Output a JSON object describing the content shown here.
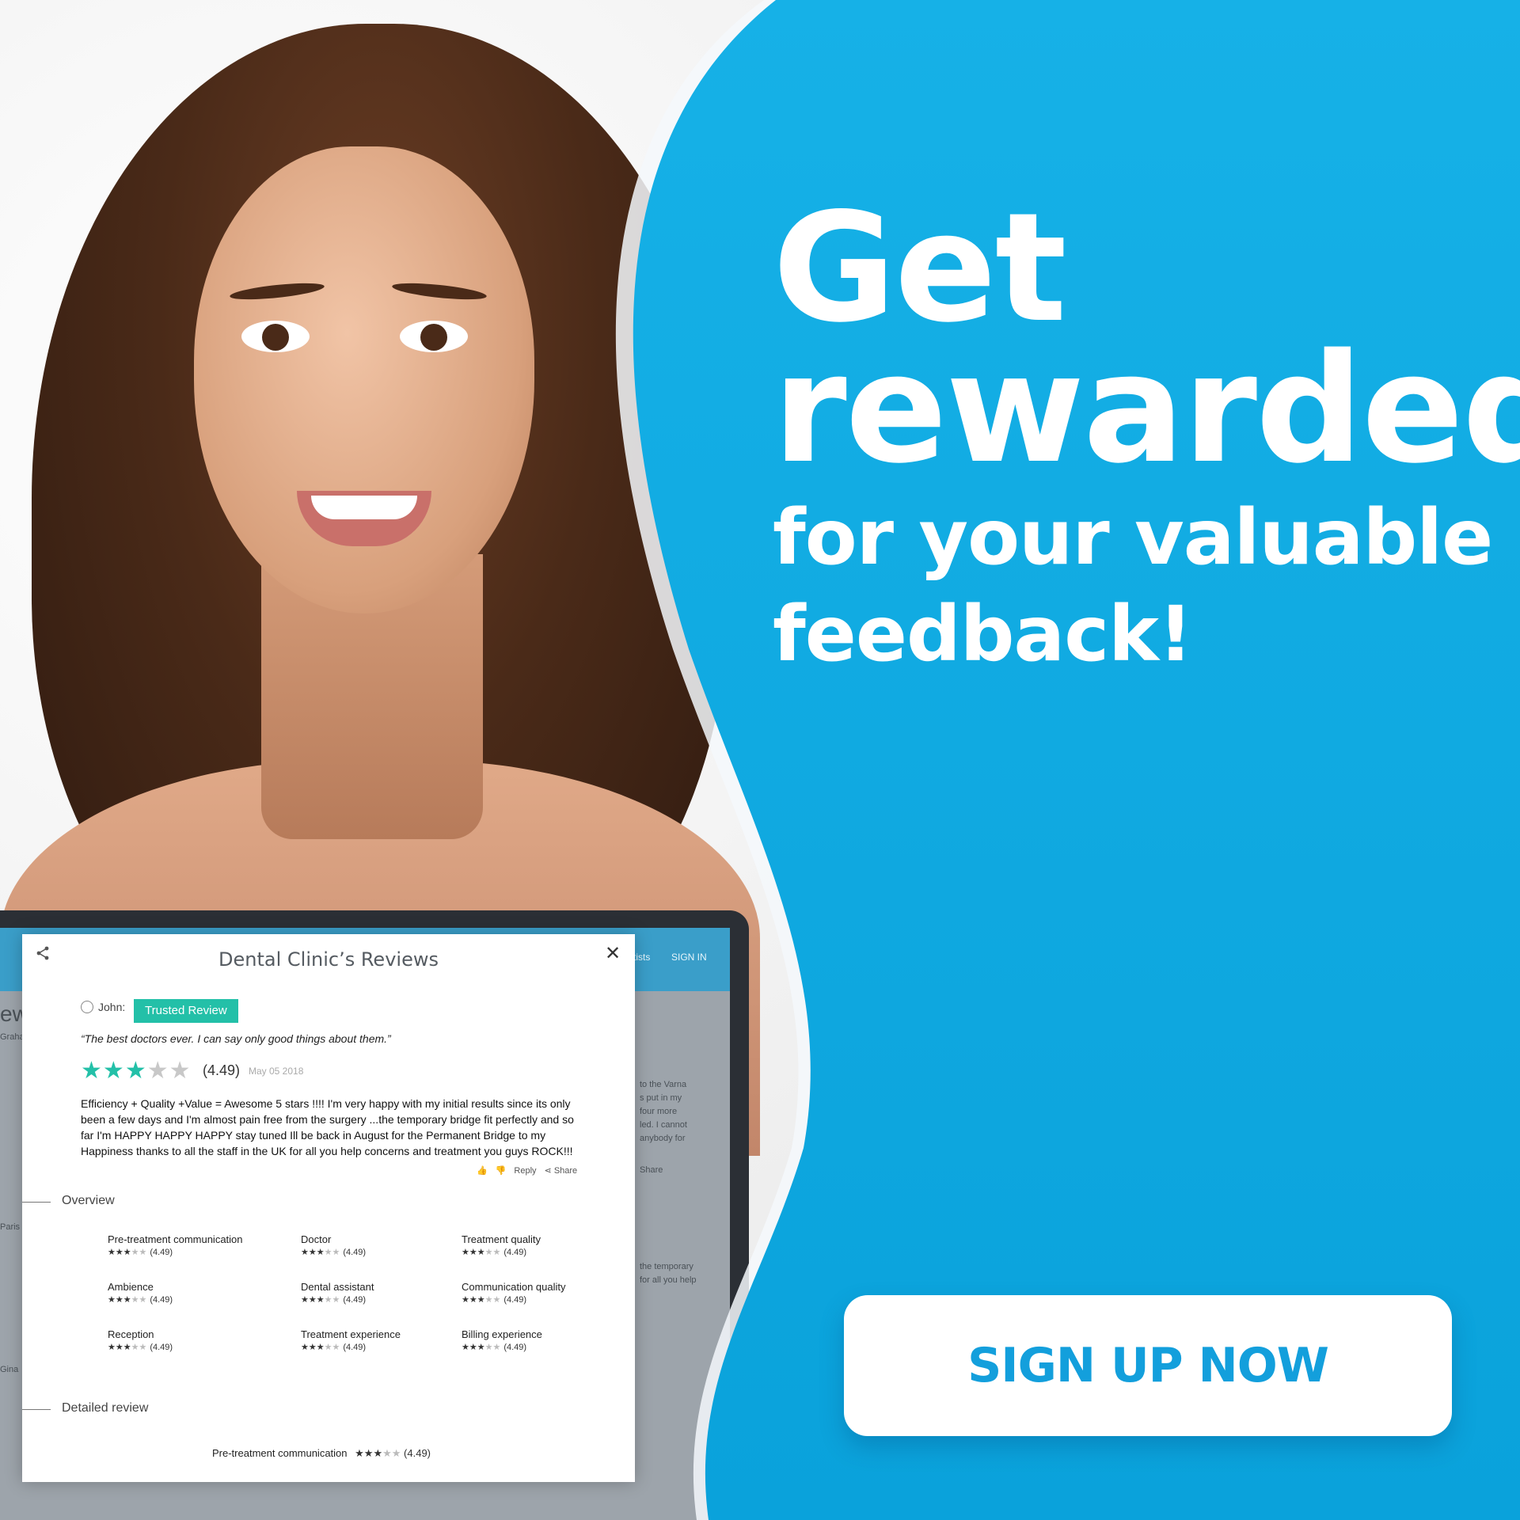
{
  "headline": {
    "line1": "Get",
    "line2": "rewarded",
    "line3": "for your valuable",
    "line4": "feedback!"
  },
  "cta": {
    "label": "SIGN UP NOW"
  },
  "colors": {
    "brand_blue": "#16a8e2",
    "accent_green": "#23c0a8",
    "white": "#ffffff"
  },
  "site_bar": {
    "nav_item": "tists",
    "sign_in": "SIGN IN"
  },
  "modal": {
    "title": "Dental Clinic’s Reviews",
    "reviewer": "John:",
    "badge": "Trusted Review",
    "quote": "“The best doctors ever. I can say only good things about them.”",
    "stars_filled": 3,
    "stars_total": 5,
    "score": "(4.49)",
    "date": "May 05 2018",
    "body": "Efficiency + Quality +Value = Awesome 5 stars !!!! I'm very happy with my initial results since its only been a few days and I'm almost pain free from the surgery ...the temporary bridge fit perfectly and so far I'm HAPPY HAPPY HAPPY stay tuned Ill be back in August for the Permanent Bridge to my Happiness thanks to all the staff in the UK for all you help concerns and treatment you guys ROCK!!!",
    "actions": {
      "reply": "Reply",
      "share": "Share"
    },
    "overview_label": "Overview",
    "ratings": [
      {
        "label": "Pre-treatment communication",
        "score": "(4.49)"
      },
      {
        "label": "Doctor",
        "score": "(4.49)"
      },
      {
        "label": "Treatment quality",
        "score": "(4.49)"
      },
      {
        "label": "Ambience",
        "score": "(4.49)"
      },
      {
        "label": "Dental assistant",
        "score": "(4.49)"
      },
      {
        "label": "Communication quality",
        "score": "(4.49)"
      },
      {
        "label": "Reception",
        "score": "(4.49)"
      },
      {
        "label": "Treatment experience",
        "score": "(4.49)"
      },
      {
        "label": "Billing experience",
        "score": "(4.49)"
      }
    ],
    "detailed_label": "Detailed review",
    "detail_first": {
      "label": "Pre-treatment communication",
      "score": "(4.49)"
    }
  },
  "background_snippets": {
    "left": [
      "ew",
      "Graha",
      "Paris",
      "Gina"
    ],
    "right": [
      "to the Varna",
      "s put in my",
      "four more",
      "led. I cannot",
      "anybody for",
      "the temporary",
      "for all you help"
    ],
    "share": "Share"
  }
}
